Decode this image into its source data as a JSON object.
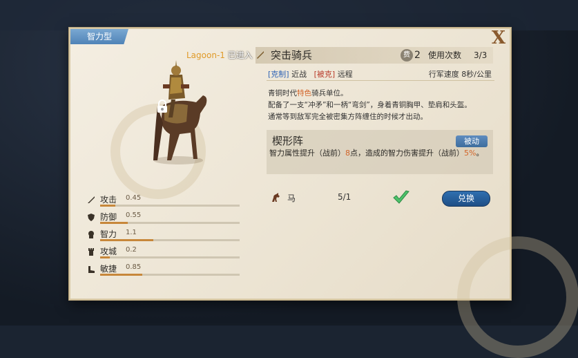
{
  "panel": {
    "ribbon_label": "智力型",
    "close_label": "X",
    "notice_player": "Lagoon-1",
    "notice_text": "已进入",
    "unit_name": "突击骑兵",
    "cost_icon_text": "费",
    "cost_value": "2",
    "uses_label": "使用次数",
    "uses_value": "3/3",
    "counter_label": "[克制]",
    "counter_value": "近战",
    "countered_label": "[被克]",
    "countered_value": "远程",
    "march_speed": "行军速度  8秒/公里",
    "desc_line1_a": "青铜时代",
    "desc_line1_hl": "特色",
    "desc_line1_b": "骑兵单位。",
    "desc_line2": "配备了一支“冲矛”和一柄“弯剑”，身着青铜胸甲、垫肩和头盔。",
    "desc_line3": "通常等到敌军完全被密集方阵缠住的时候才出动。",
    "skill_name": "楔形阵",
    "skill_tag": "被动",
    "skill_desc_a": "智力属性提升（战前）",
    "skill_desc_num": "8",
    "skill_desc_b": "点，造成的智力伤害提升（战前）",
    "skill_desc_pct": "5%",
    "skill_desc_end": "。",
    "requirement_name": "马",
    "requirement_count": "5/1",
    "exchange_label": "兑换"
  },
  "stats": [
    {
      "label": "攻击",
      "value": "0.45",
      "fraction": 0.11,
      "icon": "sword-icon"
    },
    {
      "label": "防御",
      "value": "0.55",
      "fraction": 0.2,
      "icon": "shield-icon"
    },
    {
      "label": "智力",
      "value": "1.1",
      "fraction": 0.38,
      "icon": "head-icon"
    },
    {
      "label": "攻城",
      "value": "0.2",
      "fraction": 0.07,
      "icon": "tower-icon"
    },
    {
      "label": "敏捷",
      "value": "0.85",
      "fraction": 0.3,
      "icon": "boot-icon"
    }
  ],
  "colors": {
    "accent_blue": "#2f63b5",
    "highlight_orange": "#d2652a",
    "stat_fill": "#c7873a",
    "check_green": "#4cc26a"
  }
}
